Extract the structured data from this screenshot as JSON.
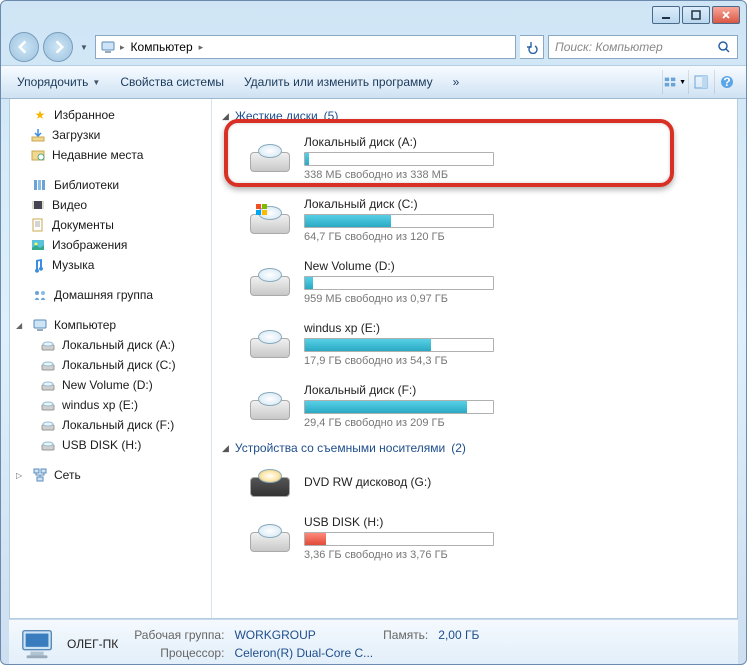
{
  "titlebar": {},
  "nav": {
    "breadcrumb": "Компьютер",
    "search_placeholder": "Поиск: Компьютер"
  },
  "toolbar": {
    "organize": "Упорядочить",
    "properties": "Свойства системы",
    "uninstall": "Удалить или изменить программу",
    "more": "»"
  },
  "sidebar": {
    "favorites": {
      "label": "Избранное",
      "items": [
        "Загрузки",
        "Недавние места"
      ]
    },
    "libraries": {
      "label": "Библиотеки",
      "items": [
        "Видео",
        "Документы",
        "Изображения",
        "Музыка"
      ]
    },
    "homegroup": {
      "label": "Домашняя группа"
    },
    "computer": {
      "label": "Компьютер",
      "items": [
        "Локальный диск (A:)",
        "Локальный диск (C:)",
        "New Volume (D:)",
        "windus xp (E:)",
        "Локальный диск (F:)",
        "USB DISK (H:)"
      ]
    },
    "network": {
      "label": "Сеть"
    }
  },
  "content": {
    "group_hdd": {
      "label": "Жесткие диски",
      "count": "(5)"
    },
    "group_removable": {
      "label": "Устройства со съемными носителями",
      "count": "(2)"
    },
    "drives": [
      {
        "name": "Локальный диск (A:)",
        "free": "338 МБ свободно из 338 МБ",
        "pct": 2,
        "color": "teal"
      },
      {
        "name": "Локальный диск (C:)",
        "free": "64,7 ГБ свободно из 120 ГБ",
        "pct": 46,
        "color": "teal",
        "win": true
      },
      {
        "name": "New Volume (D:)",
        "free": "959 МБ свободно из 0,97 ГБ",
        "pct": 4,
        "color": "teal"
      },
      {
        "name": "windus xp (E:)",
        "free": "17,9 ГБ свободно из 54,3 ГБ",
        "pct": 67,
        "color": "teal"
      },
      {
        "name": "Локальный диск (F:)",
        "free": "29,4 ГБ свободно из 209 ГБ",
        "pct": 86,
        "color": "teal"
      }
    ],
    "removable": [
      {
        "name": "DVD RW дисковод (G:)",
        "type": "dvd"
      },
      {
        "name": "USB DISK (H:)",
        "free": "3,36 ГБ свободно из 3,76 ГБ",
        "pct": 11,
        "color": "red"
      }
    ]
  },
  "status": {
    "name": "ОЛЕГ-ПК",
    "workgroup_lbl": "Рабочая группа:",
    "workgroup": "WORKGROUP",
    "memory_lbl": "Память:",
    "memory": "2,00 ГБ",
    "cpu_lbl": "Процессор:",
    "cpu": "Celeron(R) Dual-Core C..."
  }
}
